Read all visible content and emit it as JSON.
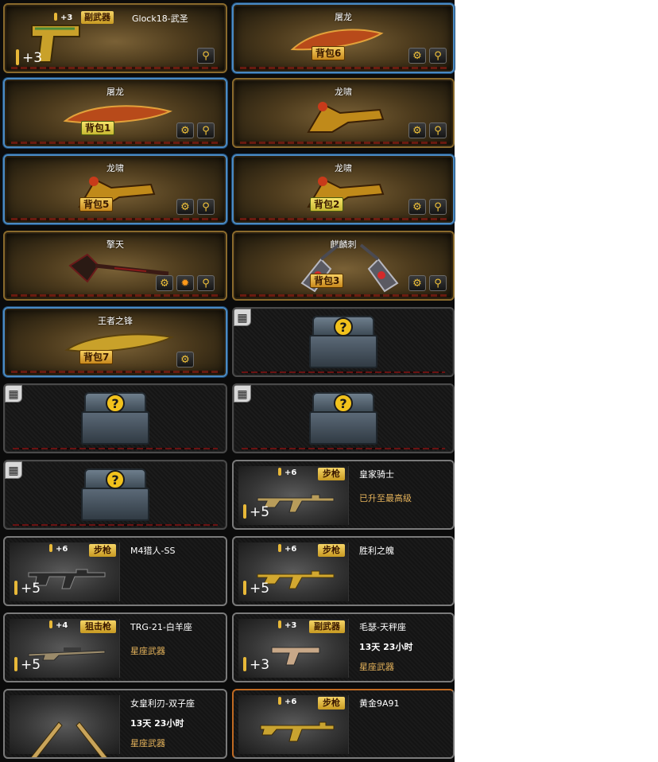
{
  "colors": {
    "gold_border": "#8a6a2c",
    "blue_border": "#4b8ac2",
    "badge_gold": "#f6d061",
    "note_text": "#e5b35b",
    "chest_question": "#f2c21c"
  },
  "weapons": [
    {
      "name": "Glock18-武圣",
      "level": "+3",
      "category": "副武器",
      "plus": "+3",
      "pack": "",
      "buttons": [
        "search-icon"
      ]
    },
    {
      "name": "屠龙",
      "pack": "背包6",
      "buttons": [
        "wrench-icon",
        "search-icon"
      ]
    },
    {
      "name": "屠龙",
      "pack": "背包1",
      "buttons": [
        "wrench-icon",
        "search-icon"
      ]
    },
    {
      "name": "龙啸",
      "pack": "",
      "buttons": [
        "wrench-icon",
        "search-icon"
      ]
    },
    {
      "name": "龙啸",
      "pack": "背包5",
      "buttons": [
        "wrench-icon",
        "search-icon"
      ]
    },
    {
      "name": "龙啸",
      "pack": "背包2",
      "buttons": [
        "wrench-icon",
        "search-icon"
      ]
    },
    {
      "name": "擎天",
      "pack": "",
      "buttons": [
        "wrench-icon",
        "gear-icon",
        "search-icon"
      ]
    },
    {
      "name": "麒麟刺",
      "pack": "背包3",
      "buttons": [
        "wrench-icon",
        "search-icon"
      ]
    },
    {
      "name": "王者之锋",
      "pack": "背包7",
      "buttons": [
        "wrench-icon"
      ]
    }
  ],
  "mystery_box": {
    "lock_icon": "grid-lock-icon",
    "symbol": "?"
  },
  "guns": [
    {
      "name": "皇家骑士",
      "level": "+6",
      "category": "步枪",
      "plus": "+5",
      "time": "",
      "note": "已升至最高级"
    },
    {
      "name": "M4猎人-SS",
      "level": "+6",
      "category": "步枪",
      "plus": "+5",
      "time": "",
      "note": ""
    },
    {
      "name": "胜利之魄",
      "level": "+6",
      "category": "步枪",
      "plus": "+5",
      "time": "",
      "note": ""
    },
    {
      "name": "TRG-21-白羊座",
      "level": "+4",
      "category": "狙击枪",
      "plus": "+5",
      "time": "",
      "note": "星座武器"
    },
    {
      "name": "毛瑟-天秤座",
      "level": "+3",
      "category": "副武器",
      "plus": "+3",
      "time": "13天 23小时",
      "note": "星座武器"
    },
    {
      "name": "女皇利刃-双子座",
      "level": "",
      "category": "",
      "plus": "",
      "time": "13天 23小时",
      "note": "星座武器"
    },
    {
      "name": "黄金9A91",
      "level": "+6",
      "category": "步枪",
      "plus": "",
      "time": "",
      "note": ""
    }
  ]
}
